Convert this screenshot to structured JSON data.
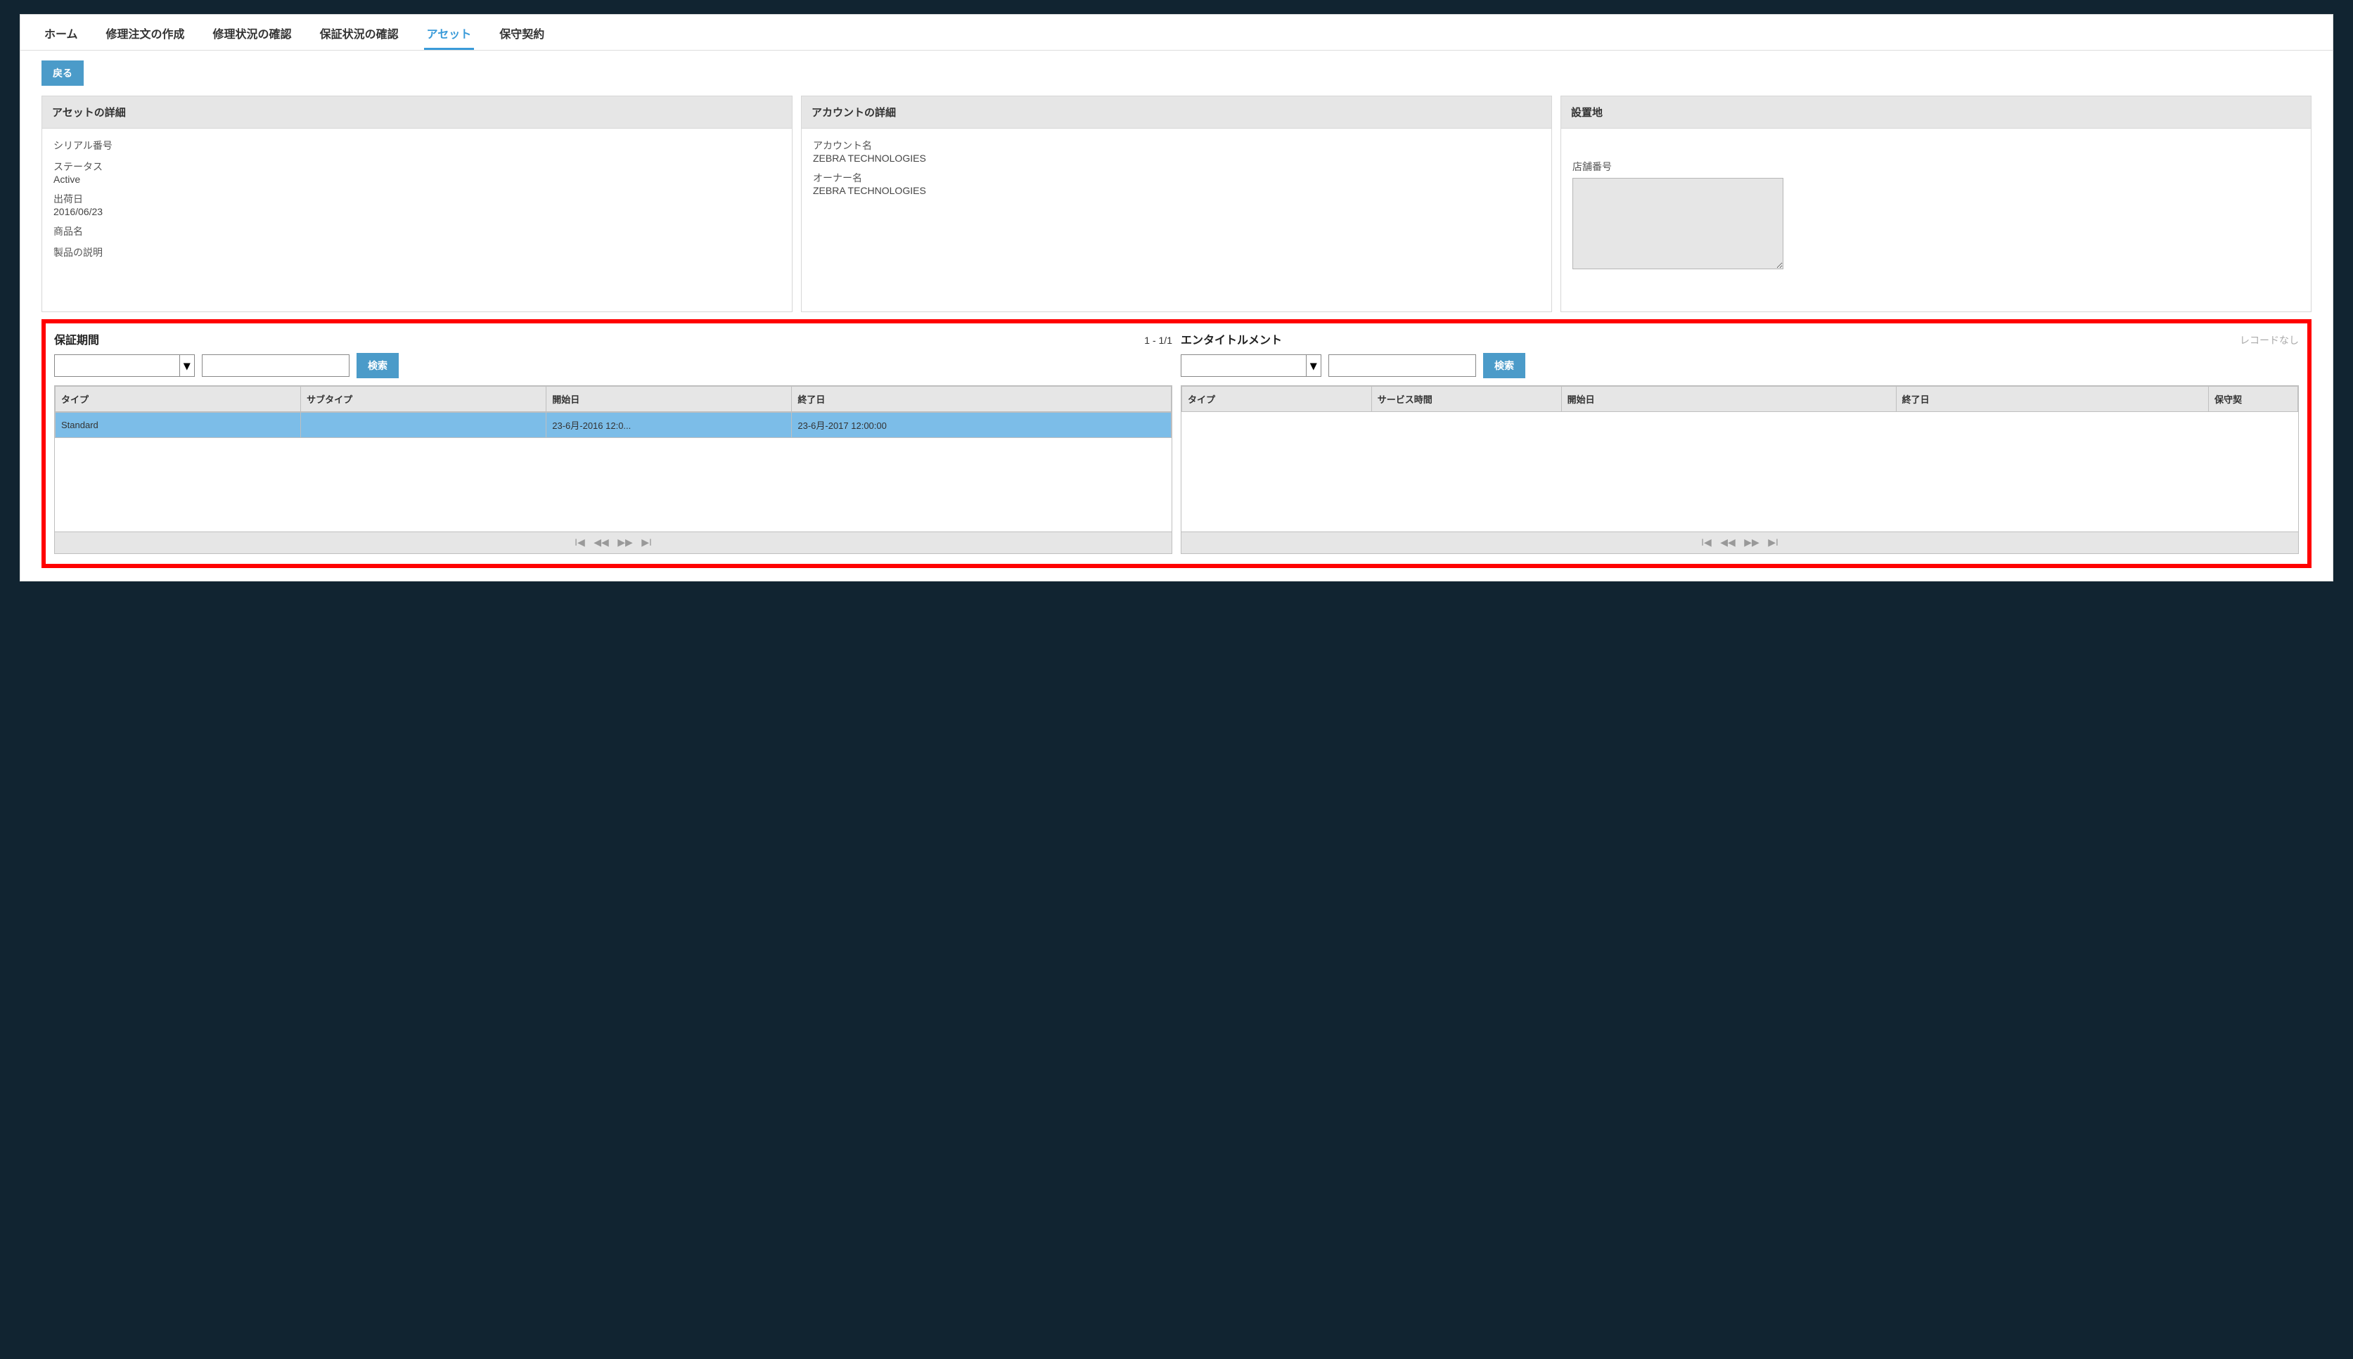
{
  "tabs": {
    "items": [
      {
        "label": "ホーム"
      },
      {
        "label": "修理注文の作成"
      },
      {
        "label": "修理状況の確認"
      },
      {
        "label": "保証状況の確認"
      },
      {
        "label": "アセット",
        "active": true
      },
      {
        "label": "保守契約"
      }
    ]
  },
  "back_button": "戻る",
  "cards": {
    "asset": {
      "title": "アセットの詳細",
      "serial_label": "シリアル番号",
      "serial_value": "",
      "status_label": "ステータス",
      "status_value": "Active",
      "ship_label": "出荷日",
      "ship_value": "2016/06/23",
      "product_label": "商品名",
      "product_value": "",
      "desc_label": "製品の説明",
      "desc_value": ""
    },
    "account": {
      "title": "アカウントの詳細",
      "account_label": "アカウント名",
      "account_value": "ZEBRA TECHNOLOGIES",
      "owner_label": "オーナー名",
      "owner_value": "ZEBRA TECHNOLOGIES"
    },
    "location": {
      "title": "設置地",
      "store_label": "店舗番号",
      "store_value": ""
    }
  },
  "warranty": {
    "title": "保証期間",
    "count": "1 - 1/1",
    "search_btn": "検索",
    "columns": [
      "タイプ",
      "サブタイプ",
      "開始日",
      "終了日"
    ],
    "rows": [
      {
        "type": "Standard",
        "subtype": "",
        "start": "23-6月-2016 12:0...",
        "end": "23-6月-2017 12:00:00"
      }
    ]
  },
  "entitlement": {
    "title": "エンタイトルメント",
    "noresult": "レコードなし",
    "search_btn": "検索",
    "columns": [
      "タイプ",
      "サービス時間",
      "開始日",
      "終了日",
      "保守契"
    ]
  },
  "pager": {
    "first": "I◀",
    "prev": "◀◀",
    "next": "▶▶",
    "last": "▶I"
  }
}
